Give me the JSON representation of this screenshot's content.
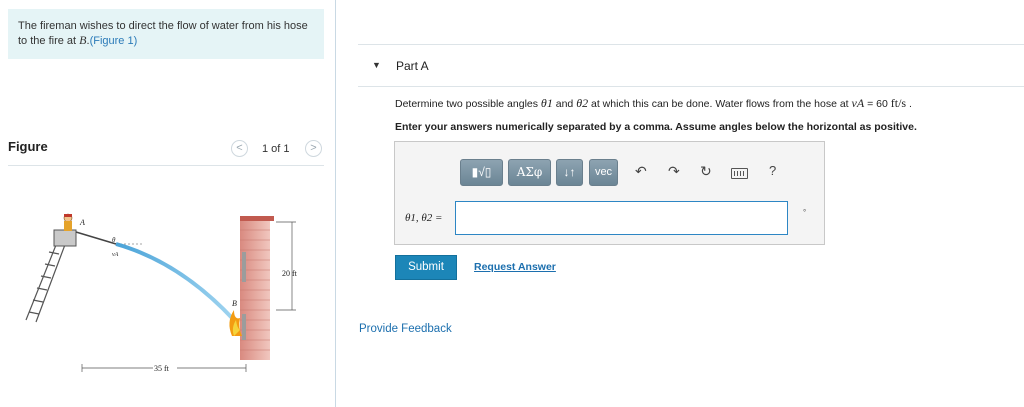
{
  "problem": {
    "text_before": "The fireman wishes to direct the flow of water from his hose to the fire at ",
    "point": "B",
    "text_after": ".",
    "figure_link": "(Figure 1)"
  },
  "figure_panel": {
    "label": "Figure",
    "pager": "1 of 1",
    "prev_icon": "chevron-left-icon",
    "next_icon": "chevron-right-icon",
    "labels": {
      "point_a": "A",
      "point_b": "B",
      "angle": "θ",
      "velocity": "vA",
      "height": "20 ft",
      "distance": "35 ft"
    }
  },
  "part": {
    "caret_icon": "caret-down-icon",
    "title": "Part A"
  },
  "question": {
    "prefix": "Determine two possible angles ",
    "theta1": "θ1",
    "and": " and ",
    "theta2": "θ2",
    "middle": " at which this can be done. Water flows from the hose at ",
    "velocity_symbol": "vA",
    "equals": " = 60 ",
    "unit": "ft/s",
    "suffix": " ."
  },
  "instruction": "Enter your answers numerically separated by a comma. Assume angles below the horizontal as positive.",
  "toolbar": {
    "templates_label": "▮√▯",
    "symbols_label": "ΑΣφ",
    "arrows_label": "↓↑",
    "vec_label": "vec",
    "undo_icon": "undo-icon",
    "redo_icon": "redo-icon",
    "reset_icon": "reset-icon",
    "keyboard_icon": "keyboard-icon",
    "help_label": "?"
  },
  "answer": {
    "label": "θ1, θ2 =",
    "value": ""
  },
  "actions": {
    "submit_label": "Submit",
    "request_answer_label": "Request Answer",
    "feedback_label": "Provide Feedback"
  },
  "colors": {
    "accent": "#1c86b8",
    "link": "#1c6fae",
    "problem_bg": "#e5f4f6"
  }
}
